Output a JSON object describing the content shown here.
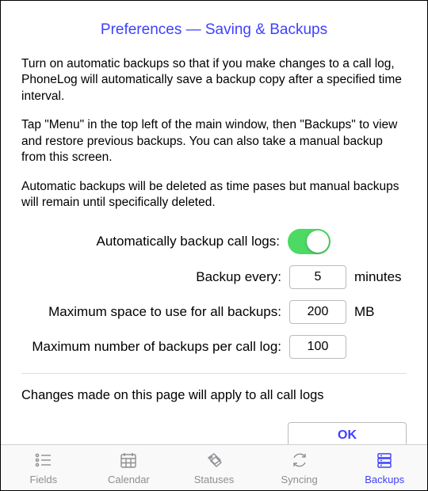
{
  "title": "Preferences — Saving & Backups",
  "paragraphs": {
    "p1": "Turn on automatic backups so that if you make changes to a call log, PhoneLog will automatically save a backup copy after a specified time interval.",
    "p2": "Tap \"Menu\" in the top left of the main window, then \"Backups\" to view and restore previous backups. You can also take a manual backup from this screen.",
    "p3": "Automatic backups will be deleted as time pases but manual backups will remain until specifically deleted."
  },
  "settings": {
    "auto_backup_label": "Automatically backup call logs:",
    "auto_backup_on": true,
    "backup_every_label": "Backup every:",
    "backup_every_value": "5",
    "backup_every_unit": "minutes",
    "max_space_label": "Maximum space to use for all backups:",
    "max_space_value": "200",
    "max_space_unit": "MB",
    "max_num_label": "Maximum number of backups per call log:",
    "max_num_value": "100"
  },
  "footnote": "Changes made on this page will apply to all call logs",
  "ok_label": "OK",
  "tabs": {
    "fields": "Fields",
    "calendar": "Calendar",
    "statuses": "Statuses",
    "syncing": "Syncing",
    "backups": "Backups"
  },
  "colors": {
    "accent": "#3e41ff",
    "toggle_on": "#4cd964",
    "inactive": "#8e8e93"
  }
}
